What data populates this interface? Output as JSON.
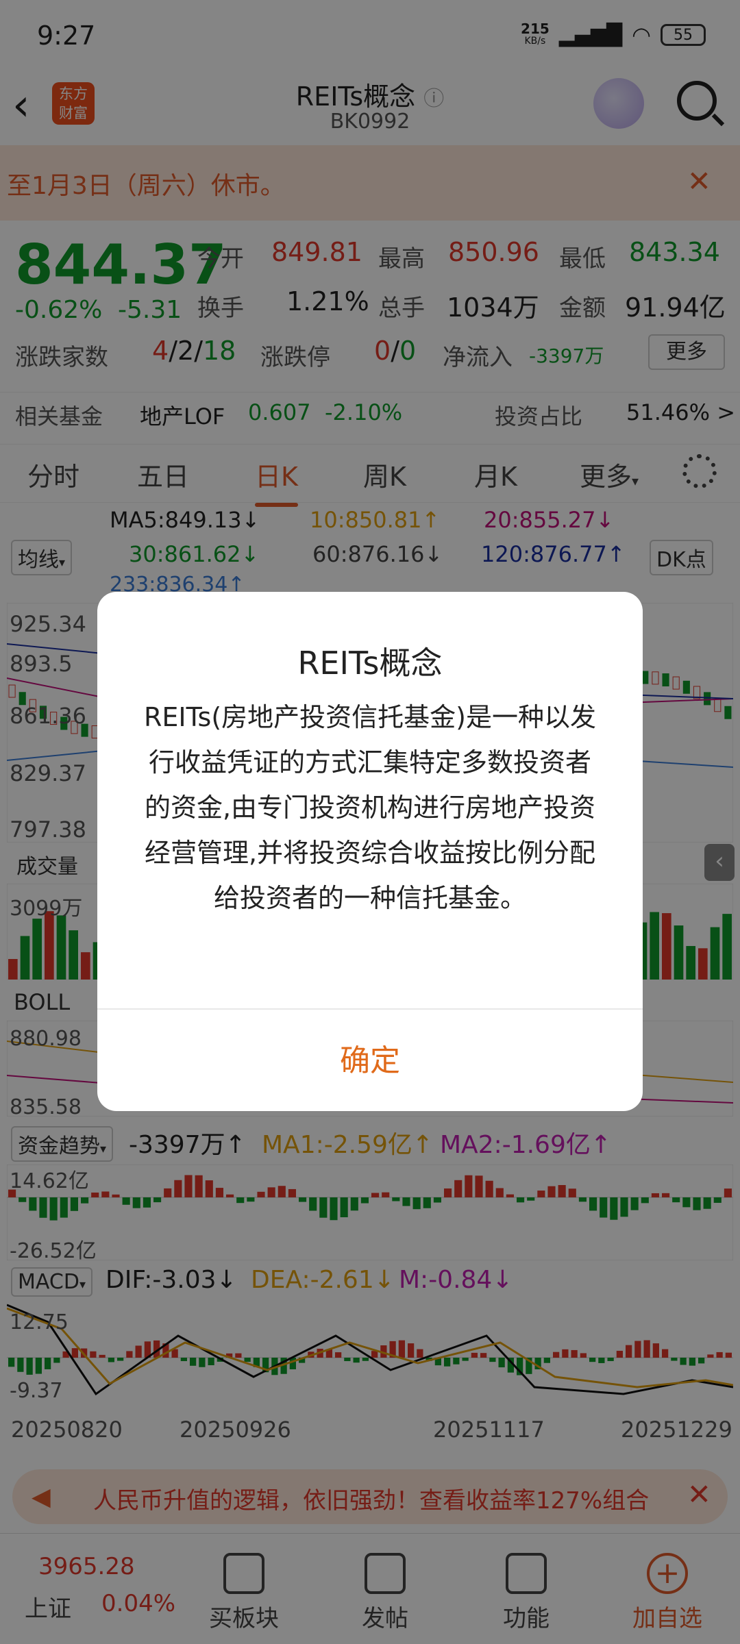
{
  "status_bar": {
    "time": "9:27",
    "speed": "215",
    "speed_unit": "KB/s",
    "network": "HD",
    "battery": "55"
  },
  "header": {
    "back_icon": "chevron-left-icon",
    "logo_line1": "东方",
    "logo_line2": "财富",
    "title": "REITs概念",
    "info_icon": "ⓘ",
    "code": "BK0992"
  },
  "notice": {
    "text": "至1月3日（周六）休市。",
    "close": "✕"
  },
  "quote": {
    "price": "844.37",
    "change_pct": "-0.62%",
    "change": "-5.31",
    "open_label": "今开",
    "open": "849.81",
    "high_label": "最高",
    "high": "850.96",
    "low_label": "最低",
    "low": "843.34",
    "turnover_label": "换手",
    "turnover": "1.21%",
    "volume_label": "总手",
    "volume": "1034万",
    "amount_label": "金额",
    "amount": "91.94亿",
    "updown_label": "涨跌家数",
    "up": "4",
    "flat": "2",
    "down": "18",
    "limit_label": "涨跌停",
    "limit_up": "0",
    "limit_down": "0",
    "inflow_label": "净流入",
    "inflow": "-3397万",
    "more": "更多"
  },
  "fund": {
    "label": "相关基金",
    "name": "地产LOF",
    "price": "0.607",
    "chg": "-2.10%",
    "ratio_label": "投资占比",
    "ratio": "51.46% >"
  },
  "tabs": [
    "分时",
    "五日",
    "日K",
    "周K",
    "月K",
    "更多"
  ],
  "ma": {
    "selector": "均线",
    "ma5": "MA5:849.13↓",
    "ma10": "10:850.81↑",
    "ma20": "20:855.27↓",
    "ma30": "30:861.62↓",
    "ma60": "60:876.16↓",
    "ma120": "120:876.77↑",
    "ma233": "233:836.34↑",
    "dk": "DK点"
  },
  "kline_axis": [
    "925.34",
    "893.5",
    "861.36",
    "829.37",
    "797.38"
  ],
  "volume": {
    "selector": "成交量",
    "axis_top": "3099万"
  },
  "boll": {
    "selector": "BOLL",
    "axis_top": "880.98",
    "axis_bottom": "835.58"
  },
  "fund_trend": {
    "selector": "资金趋势",
    "value": "-3397万↑",
    "ma1": "MA1:-2.59亿↑",
    "ma2": "MA2:-1.69亿↑",
    "axis_top": "14.62亿",
    "axis_bottom": "-26.52亿"
  },
  "macd": {
    "selector": "MACD",
    "dif": "DIF:-3.03↓",
    "dea": "DEA:-2.61↓",
    "m": "M:-0.84↓",
    "axis_top": "12.75",
    "axis_bottom": "-9.37"
  },
  "dates": [
    "20250820",
    "20250926",
    "20251117",
    "20251229"
  ],
  "dialog": {
    "title": "REITs概念",
    "body": "REITs(房地产投资信托基金)是一种以发行收益凭证的方式汇集特定多数投资者的资金,由专门投资机构进行房地产投资经营管理,并将投资综合收益按比例分配给投资者的一种信托基金。",
    "confirm": "确定"
  },
  "ad": {
    "text": "人民币升值的逻辑，依旧强劲！查看收益率127%组合",
    "close": "✕"
  },
  "bottom_nav": {
    "index_value": "3965.28",
    "index_name": "上证",
    "index_change": "0.04%",
    "items": [
      "买板块",
      "发帖",
      "功能",
      "加自选"
    ]
  }
}
